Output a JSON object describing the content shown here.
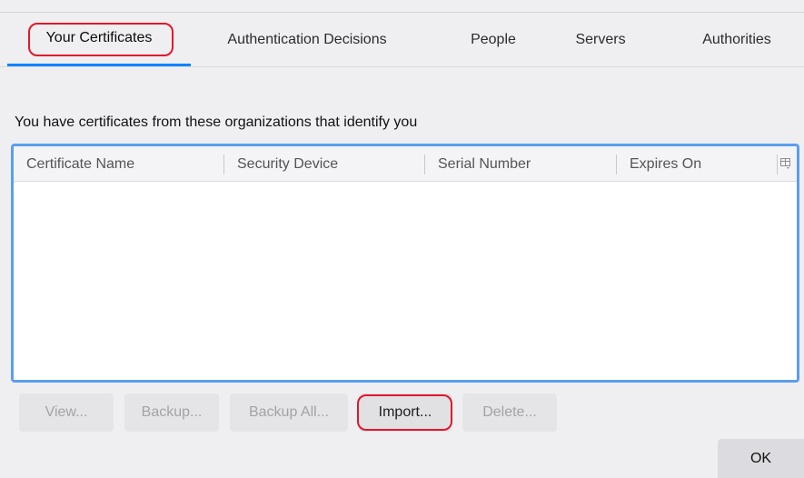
{
  "tabs": [
    {
      "label": "Your Certificates",
      "selected": true
    },
    {
      "label": "Authentication Decisions",
      "selected": false
    },
    {
      "label": "People",
      "selected": false
    },
    {
      "label": "Servers",
      "selected": false
    },
    {
      "label": "Authorities",
      "selected": false
    }
  ],
  "description": "You have certificates from these organizations that identify you",
  "table": {
    "columns": [
      "Certificate Name",
      "Security Device",
      "Serial Number",
      "Expires On"
    ],
    "column_picker_icon": "column-picker-icon",
    "rows": []
  },
  "buttons": {
    "view": "View...",
    "backup": "Backup...",
    "backup_all": "Backup All...",
    "import": "Import...",
    "delete": "Delete...",
    "ok": "OK"
  },
  "colors": {
    "accent": "#0a84ff",
    "focus_ring": "#5a9ef0",
    "annotation": "#e3162b"
  }
}
